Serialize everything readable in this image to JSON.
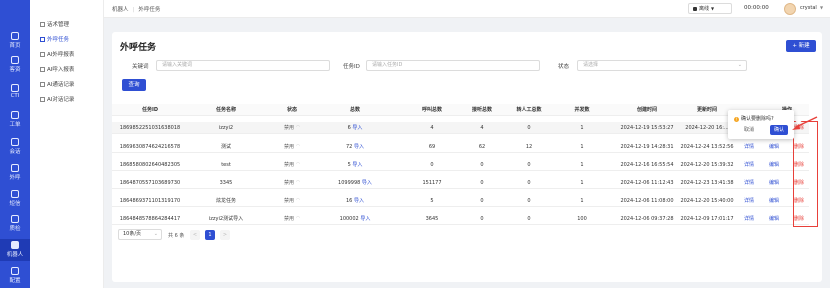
{
  "rail": [
    {
      "label": "首页",
      "icon": "home-icon"
    },
    {
      "label": "客资",
      "icon": "customers-icon"
    },
    {
      "label": "CTI",
      "icon": "cti-icon"
    },
    {
      "label": "工单",
      "icon": "ticket-icon"
    },
    {
      "label": "会话",
      "icon": "chat-icon"
    },
    {
      "label": "外呼",
      "icon": "outbound-call-icon"
    },
    {
      "label": "短信",
      "icon": "sms-icon"
    },
    {
      "label": "质检",
      "icon": "quality-icon"
    },
    {
      "label": "机器人",
      "icon": "robot-icon"
    },
    {
      "label": "配置",
      "icon": "settings-icon"
    }
  ],
  "submenu": [
    "话术管理",
    "外呼任务",
    "AI外呼报表",
    "AI呼入报表",
    "AI通话记录",
    "AI对话记录"
  ],
  "breadcrumb": {
    "root": "机器人",
    "current": "外呼任务"
  },
  "topbar": {
    "status": "离线",
    "timer": "00:00:00",
    "username": "crystal"
  },
  "page": {
    "title": "外呼任务",
    "new_button": "+ 新建"
  },
  "filters": {
    "keyword_label": "关键词",
    "keyword_placeholder": "请输入关键词",
    "task_id_label": "任务ID",
    "task_id_placeholder": "请输入任务ID",
    "status_label": "状态",
    "status_placeholder": "请选择",
    "query_button": "查询"
  },
  "table": {
    "columns": [
      "任务ID",
      "任务名称",
      "状态",
      "总数",
      "呼叫总数",
      "接听总数",
      "转人工总数",
      "并发数",
      "创建时间",
      "更新时间",
      "操作"
    ],
    "rows": [
      {
        "id": "1869852251031638018",
        "name": "izzyi2",
        "status": "禁用",
        "total": "6",
        "import": "导入",
        "calls": "4",
        "answered": "4",
        "transfer": "0",
        "concurrency": "1",
        "created": "2024-12-19 15:53:27",
        "updated": "2024-12-20 16:...",
        "detail": "详情",
        "edit": "编辑",
        "del": "删除"
      },
      {
        "id": "1869630874624216578",
        "name": "测试",
        "status": "禁用",
        "total": "72",
        "import": "导入",
        "calls": "69",
        "answered": "62",
        "transfer": "12",
        "concurrency": "1",
        "created": "2024-12-19 14:28:31",
        "updated": "2024-12-24 13:52:56",
        "detail": "详情",
        "edit": "编辑",
        "del": "删除"
      },
      {
        "id": "1868580802640482305",
        "name": "test",
        "status": "禁用",
        "total": "5",
        "import": "导入",
        "calls": "0",
        "answered": "0",
        "transfer": "0",
        "concurrency": "1",
        "created": "2024-12-16 16:55:54",
        "updated": "2024-12-20 15:39:32",
        "detail": "详情",
        "edit": "编辑",
        "del": "删除"
      },
      {
        "id": "1864870557103689730",
        "name": "3345",
        "status": "禁用",
        "total": "1099998",
        "import": "导入",
        "calls": "151177",
        "answered": "0",
        "transfer": "0",
        "concurrency": "1",
        "created": "2024-12-06 11:12:43",
        "updated": "2024-12-23 13:41:38",
        "detail": "详情",
        "edit": "编辑",
        "del": "删除"
      },
      {
        "id": "1864869371101319170",
        "name": "炫龙任务",
        "status": "禁用",
        "total": "16",
        "import": "导入",
        "calls": "5",
        "answered": "0",
        "transfer": "0",
        "concurrency": "1",
        "created": "2024-12-06 11:08:00",
        "updated": "2024-12-20 15:40:00",
        "detail": "详情",
        "edit": "编辑",
        "del": "删除"
      },
      {
        "id": "1864848578864284417",
        "name": "izzyi2测试导入",
        "status": "禁用",
        "total": "100002",
        "import": "导入",
        "calls": "3645",
        "answered": "0",
        "transfer": "0",
        "concurrency": "100",
        "created": "2024-12-06 09:37:28",
        "updated": "2024-12-09 17:01:17",
        "detail": "详情",
        "edit": "编辑",
        "del": "删除"
      }
    ]
  },
  "popconfirm": {
    "message": "确认要删除吗?",
    "cancel": "取消",
    "ok": "确认"
  },
  "pagination": {
    "page_size": "10条/页",
    "total": "共 6 条",
    "prev": "<",
    "current": "1",
    "next": ">"
  },
  "colors": {
    "primary": "#2f4fd3",
    "danger": "#e8403a",
    "warning": "#f5a623"
  }
}
